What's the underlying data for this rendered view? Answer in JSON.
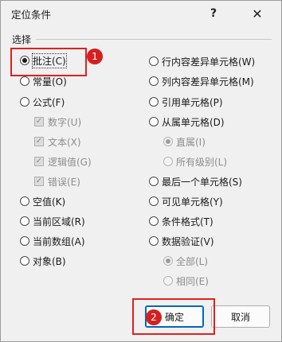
{
  "window": {
    "title": "定位条件",
    "help_glyph": "?",
    "close_glyph": "✕"
  },
  "group": {
    "label": "选择"
  },
  "left_options": [
    {
      "label": "批注(C)",
      "checked": true
    },
    {
      "label": "常量(O)"
    },
    {
      "label": "公式(F)"
    },
    {
      "label": "数字(U)",
      "disabled": true,
      "checked": true
    },
    {
      "label": "文本(X)",
      "disabled": true,
      "checked": true
    },
    {
      "label": "逻辑值(G)",
      "disabled": true,
      "checked": true
    },
    {
      "label": "错误(E)",
      "disabled": true,
      "checked": true
    },
    {
      "label": "空值(K)"
    },
    {
      "label": "当前区域(R)"
    },
    {
      "label": "当前数组(A)"
    },
    {
      "label": "对象(B)"
    }
  ],
  "right_options": [
    {
      "label": "行内容差异单元格(W)"
    },
    {
      "label": "列内容差异单元格(M)"
    },
    {
      "label": "引用单元格(P)"
    },
    {
      "label": "从属单元格(D)"
    },
    {
      "label": "直属(I)",
      "disabled": true,
      "checked": true
    },
    {
      "label": "所有级别(L)",
      "disabled": true
    },
    {
      "label": "最后一个单元格(S)"
    },
    {
      "label": "可见单元格(Y)"
    },
    {
      "label": "条件格式(T)"
    },
    {
      "label": "数据验证(V)"
    },
    {
      "label": "全部(L)",
      "disabled": true,
      "checked": true
    },
    {
      "label": "相同(E)",
      "disabled": true
    }
  ],
  "buttons": {
    "ok": "确定",
    "cancel": "取消"
  },
  "annotations": {
    "badge1": "1",
    "badge2": "2",
    "color": "#e02020"
  }
}
